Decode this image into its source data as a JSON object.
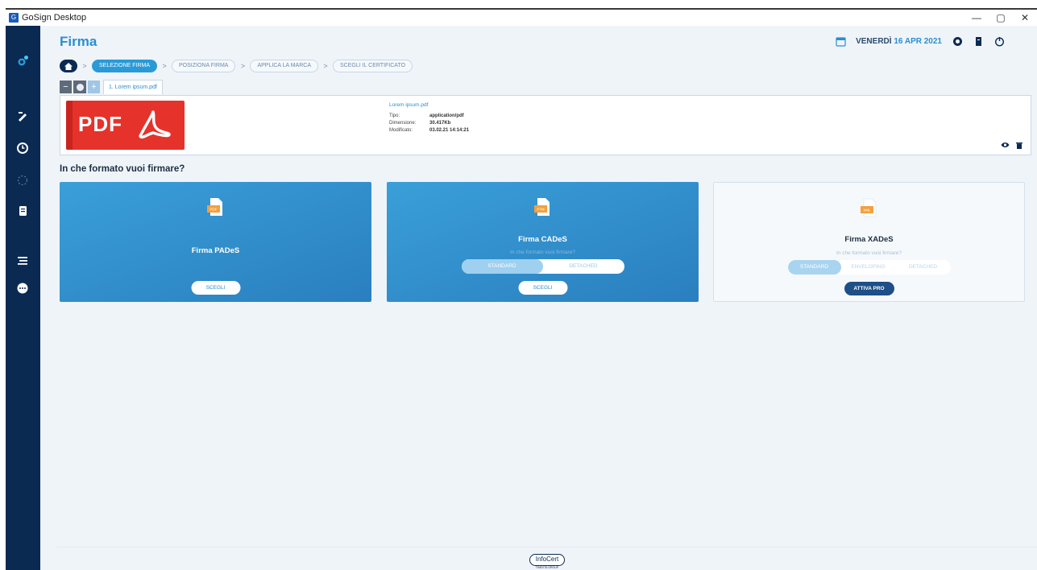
{
  "window": {
    "title": "GoSign Desktop",
    "app_icon": "G",
    "controls": [
      "—",
      "▢",
      "✕"
    ]
  },
  "sidebar": {
    "items": [
      {
        "icon": "gosign-logo-icon"
      },
      {
        "icon": "sign-pen-icon"
      },
      {
        "icon": "clock-icon"
      },
      {
        "icon": "spinner-icon"
      },
      {
        "icon": "document-stack-icon"
      },
      {
        "icon": "list-icon"
      },
      {
        "icon": "more-icon"
      }
    ]
  },
  "header": {
    "title": "Firma",
    "date_day": "VENERDÌ",
    "date_value": "16 APR 2021"
  },
  "breadcrumb": {
    "steps": [
      "SELEZIONE FIRMA",
      "POSIZIONA FIRMA",
      "APPLICA LA MARCA",
      "SCEGLI IL CERTIFICATO"
    ],
    "active_index": 0
  },
  "filetabs": {
    "minus": "−",
    "plus": "+",
    "tab_label": "1. Lorem ipsum.pdf"
  },
  "file": {
    "thumb_text": "PDF",
    "name": "Lorem ipsum.pdf",
    "rows": [
      {
        "key": "Tipo:",
        "value": "application/pdf"
      },
      {
        "key": "Dimensione:",
        "value": "30.417Kb"
      },
      {
        "key": "Modificato:",
        "value": "03.02.21 14:14:21"
      }
    ]
  },
  "question": "In che formato vuoi firmare?",
  "options": [
    {
      "badge": "PDF",
      "title": "Firma PADeS",
      "button": "SCEGLI"
    },
    {
      "badge": "P7M",
      "title": "Firma CADeS",
      "subtitle": "In che formato vuoi firmare?",
      "toggle": [
        "STANDARD",
        "DETACHED"
      ],
      "button": "SCEGLI"
    },
    {
      "badge": "XML",
      "title": "Firma XADeS",
      "subtitle": "In che formato vuoi firmare?",
      "toggle": [
        "STANDARD",
        "ENVELOPING",
        "DETACHED"
      ],
      "button": "ATTIVA PRO"
    }
  ],
  "footer": {
    "logo": "InfoCert",
    "sub": "TINEXTA GROUP"
  },
  "colors": {
    "sidebar": "#0a2a52",
    "accent": "#2a8fd0",
    "card_blue": "#3a9fd8",
    "pdf_red": "#e5322b"
  }
}
